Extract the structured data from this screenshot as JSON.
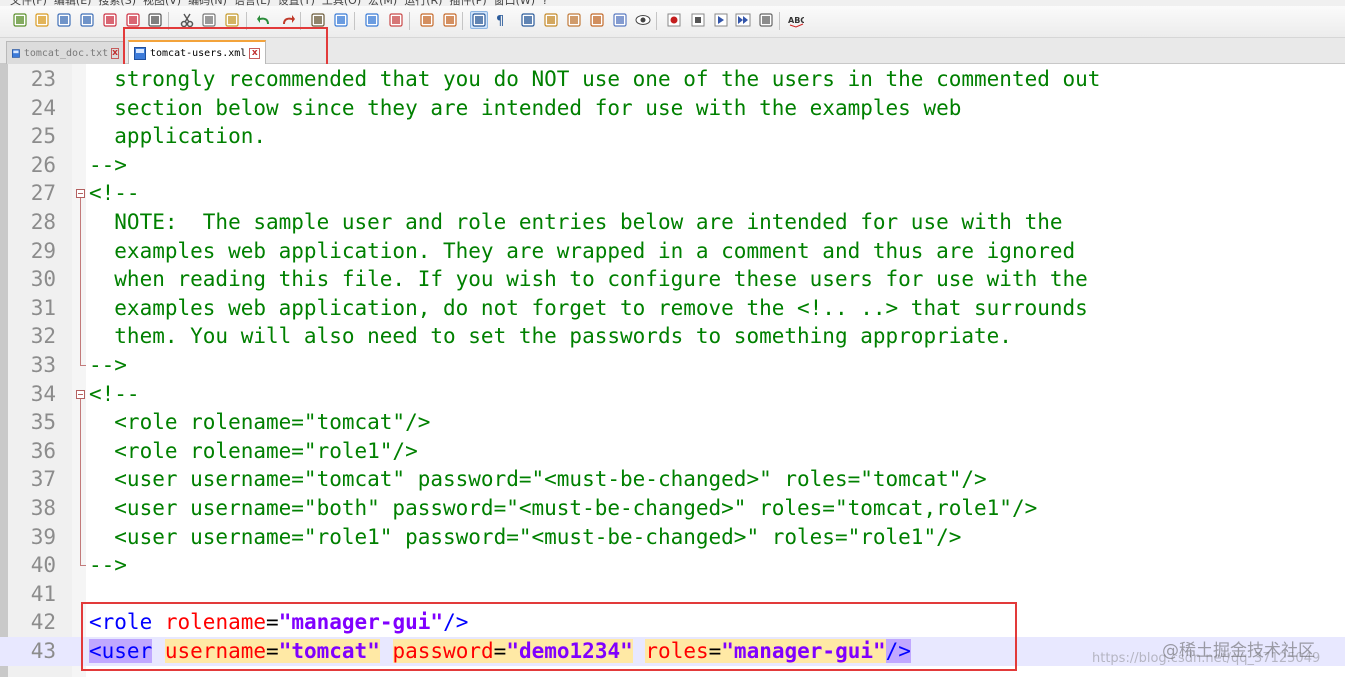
{
  "toolbar": {
    "icons": [
      "new-file-icon",
      "open-file-icon",
      "save-icon",
      "save-all-icon",
      "close-icon",
      "close-all-icon",
      "print-icon",
      "cut-icon",
      "copy-icon",
      "paste-icon",
      "undo-icon",
      "redo-icon",
      "find-icon",
      "replace-icon",
      "zoom-in-icon",
      "zoom-out-icon",
      "sync-vertical-icon",
      "sync-horizontal-icon",
      "word-wrap-icon",
      "show-all-chars-icon",
      "indent-guide-icon",
      "user-lang-icon",
      "function-list-icon",
      "folder-workspace-icon",
      "doc-map-icon",
      "monitor-icon",
      "record-macro-icon",
      "stop-macro-icon",
      "play-macro-icon",
      "run-macro-multiple-icon",
      "save-macro-icon",
      "spell-check-icon"
    ]
  },
  "tabs": [
    {
      "label": "tomcat_doc.txt",
      "active": false
    },
    {
      "label": "tomcat-users.xml",
      "active": true
    }
  ],
  "editor": {
    "lines": [
      {
        "num": "23",
        "segments": [
          {
            "t": "  strongly recommended that you do NOT use one of the users in the commented out",
            "c": "cm"
          }
        ]
      },
      {
        "num": "24",
        "segments": [
          {
            "t": "  section below since they are intended for use with the examples web",
            "c": "cm"
          }
        ]
      },
      {
        "num": "25",
        "segments": [
          {
            "t": "  application.",
            "c": "cm"
          }
        ]
      },
      {
        "num": "26",
        "segments": [
          {
            "t": "-->",
            "c": "cm"
          }
        ]
      },
      {
        "num": "27",
        "segments": [
          {
            "t": "<!--",
            "c": "cm"
          }
        ]
      },
      {
        "num": "28",
        "segments": [
          {
            "t": "  NOTE:  The sample user and role entries below are intended for use with the",
            "c": "cm"
          }
        ]
      },
      {
        "num": "29",
        "segments": [
          {
            "t": "  examples web application. They are wrapped in a comment and thus are ignored",
            "c": "cm"
          }
        ]
      },
      {
        "num": "30",
        "segments": [
          {
            "t": "  when reading this file. If you wish to configure these users for use with the",
            "c": "cm"
          }
        ]
      },
      {
        "num": "31",
        "segments": [
          {
            "t": "  examples web application, do not forget to remove the <!.. ..> that surrounds",
            "c": "cm"
          }
        ]
      },
      {
        "num": "32",
        "segments": [
          {
            "t": "  them. You will also need to set the passwords to something appropriate.",
            "c": "cm"
          }
        ]
      },
      {
        "num": "33",
        "segments": [
          {
            "t": "-->",
            "c": "cm"
          }
        ]
      },
      {
        "num": "34",
        "segments": [
          {
            "t": "<!--",
            "c": "cm"
          }
        ]
      },
      {
        "num": "35",
        "segments": [
          {
            "t": "  <role rolename=\"tomcat\"/>",
            "c": "cm"
          }
        ]
      },
      {
        "num": "36",
        "segments": [
          {
            "t": "  <role rolename=\"role1\"/>",
            "c": "cm"
          }
        ]
      },
      {
        "num": "37",
        "segments": [
          {
            "t": "  <user username=\"tomcat\" password=\"<must-be-changed>\" roles=\"tomcat\"/>",
            "c": "cm"
          }
        ]
      },
      {
        "num": "38",
        "segments": [
          {
            "t": "  <user username=\"both\" password=\"<must-be-changed>\" roles=\"tomcat,role1\"/>",
            "c": "cm"
          }
        ]
      },
      {
        "num": "39",
        "segments": [
          {
            "t": "  <user username=\"role1\" password=\"<must-be-changed>\" roles=\"role1\"/>",
            "c": "cm"
          }
        ]
      },
      {
        "num": "40",
        "segments": [
          {
            "t": "-->",
            "c": "cm"
          }
        ]
      },
      {
        "num": "41",
        "segments": []
      },
      {
        "num": "42",
        "segments": [
          {
            "t": "<role",
            "c": "tg"
          },
          {
            "t": " ",
            "c": "eq"
          },
          {
            "t": "rolename",
            "c": "at"
          },
          {
            "t": "=",
            "c": "eq"
          },
          {
            "t": "\"manager-gui\"",
            "c": "val"
          },
          {
            "t": "/>",
            "c": "tg"
          }
        ]
      },
      {
        "num": "43",
        "current": true,
        "segments": [
          {
            "t": "<user",
            "c": "tg hl-tag"
          },
          {
            "t": " ",
            "c": "eq"
          },
          {
            "t": "username",
            "c": "at hl-word"
          },
          {
            "t": "=",
            "c": "eq hl-word"
          },
          {
            "t": "\"tomcat\"",
            "c": "val hl-word"
          },
          {
            "t": " ",
            "c": "eq"
          },
          {
            "t": "password",
            "c": "at hl-word"
          },
          {
            "t": "=",
            "c": "eq hl-word"
          },
          {
            "t": "\"demo1234\"",
            "c": "val hl-word"
          },
          {
            "t": " ",
            "c": "eq"
          },
          {
            "t": "roles",
            "c": "at hl-word"
          },
          {
            "t": "=",
            "c": "eq hl-word"
          },
          {
            "t": "\"manager-gui\"",
            "c": "val hl-word"
          },
          {
            "t": "/>",
            "c": "tg hl-tag"
          }
        ]
      }
    ]
  },
  "watermark": {
    "text": "@稀土掘金技术社区",
    "url": "https://blog.csdn.net/qq_37125049"
  }
}
